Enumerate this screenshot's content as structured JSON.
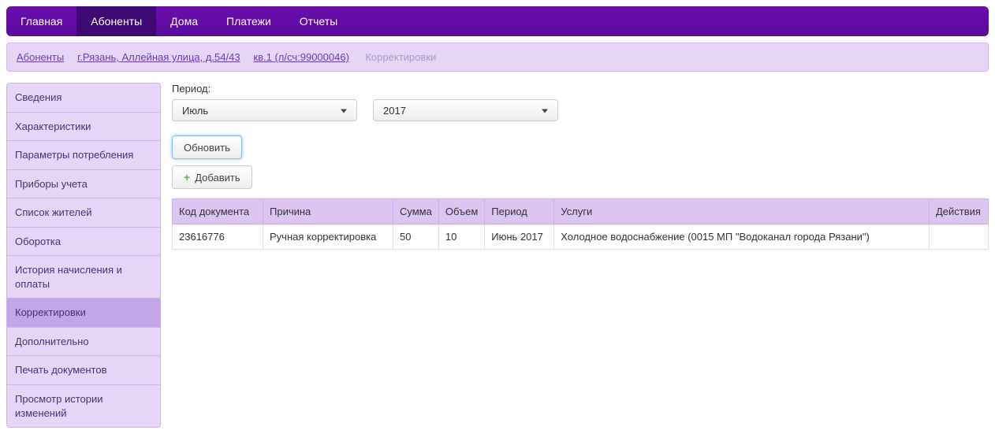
{
  "top_nav": {
    "items": [
      {
        "label": "Главная",
        "active": false
      },
      {
        "label": "Абоненты",
        "active": true
      },
      {
        "label": "Дома",
        "active": false
      },
      {
        "label": "Платежи",
        "active": false
      },
      {
        "label": "Отчеты",
        "active": false
      }
    ]
  },
  "breadcrumb": {
    "links": [
      "Абоненты",
      "г.Рязань, Аллейная улица, д.54/43",
      " кв.1 (л/сч:99000046)"
    ],
    "current": "Корректировки"
  },
  "sidebar": {
    "items": [
      {
        "label": "Сведения",
        "active": false
      },
      {
        "label": "Характеристики",
        "active": false
      },
      {
        "label": "Параметры потребления",
        "active": false
      },
      {
        "label": "Приборы учета",
        "active": false
      },
      {
        "label": "Список жителей",
        "active": false
      },
      {
        "label": "Оборотка",
        "active": false
      },
      {
        "label": "История начисления и оплаты",
        "active": false
      },
      {
        "label": "Корректировки",
        "active": true
      },
      {
        "label": "Дополнительно",
        "active": false
      },
      {
        "label": "Печать документов",
        "active": false
      },
      {
        "label": "Просмотр истории изменений",
        "active": false
      }
    ]
  },
  "main": {
    "period_label": "Период:",
    "month_select": {
      "value": "Июль"
    },
    "year_select": {
      "value": "2017"
    },
    "refresh_button": "Обновить",
    "add_button": "Добавить",
    "table": {
      "headers": [
        "Код документа",
        "Причина",
        "Сумма",
        "Объем",
        "Период",
        "Услуги",
        "Действия"
      ],
      "rows": [
        {
          "doc_code": "23616776",
          "reason": "Ручная корректировка",
          "sum": "50",
          "volume": "10",
          "period": "Июнь 2017",
          "services": "Холодное водоснабжение (0015 МП \"Водоканал города Рязани\")",
          "actions": ""
        }
      ]
    }
  }
}
